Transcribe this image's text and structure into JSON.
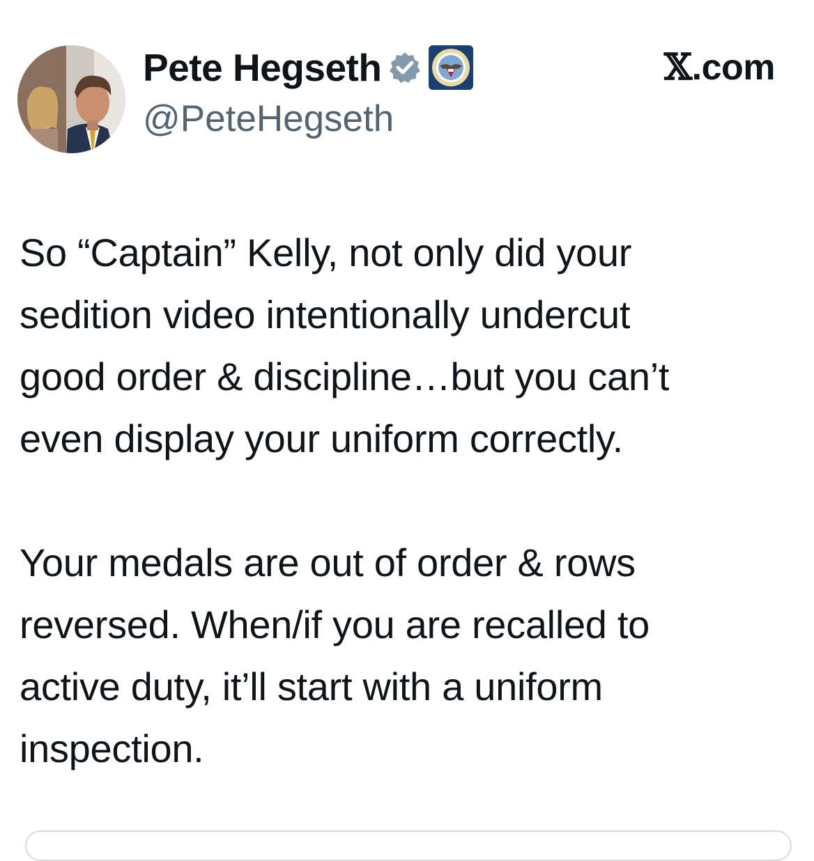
{
  "tweet": {
    "display_name": "Pete Hegseth",
    "handle": "@PeteHegseth",
    "source": "X.com",
    "text": "So “Captain” Kelly, not only did your\nsedition video intentionally undercut\ngood order & discipline…but you can’t\neven display your uniform correctly.\n\nYour medals are out of order & rows\nreversed. When/if you are recalled to\nactive duty, it’ll start with a uniform\ninspection."
  },
  "icons": {
    "verified": "verified-badge-icon",
    "affiliation": "department-of-war-seal-icon",
    "avatar": "profile-avatar"
  },
  "colors": {
    "text": "#0f1419",
    "secondary": "#536471",
    "verified_badge": "#829aab",
    "seal_blue": "#1c3f72"
  }
}
